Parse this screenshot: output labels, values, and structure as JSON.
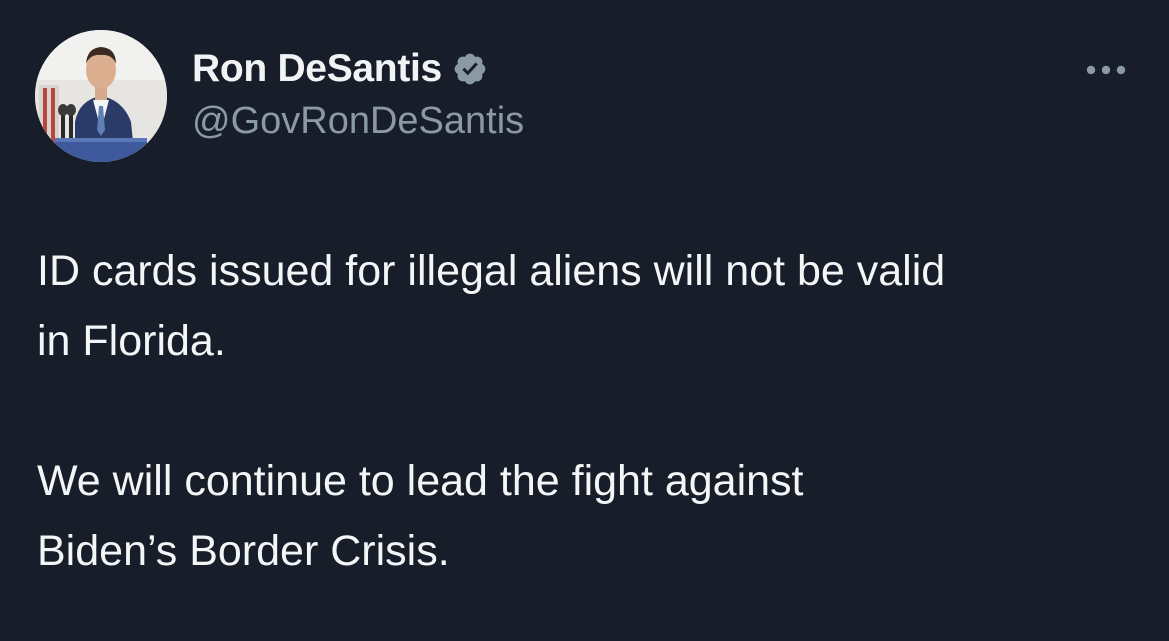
{
  "author": {
    "display_name": "Ron DeSantis",
    "handle": "@GovRonDeSantis",
    "verified": true,
    "verified_color": "#8b98a5"
  },
  "icons": {
    "verified": "verified-badge-icon",
    "more": "more-options-icon"
  },
  "tweet": {
    "paragraphs": [
      {
        "lines": [
          "ID cards issued for illegal aliens will not be valid",
          "in Florida."
        ]
      },
      {
        "lines": [
          "We will continue to lead the fight against",
          "Biden’s Border Crisis."
        ]
      }
    ]
  },
  "colors": {
    "background": "#171e29",
    "primary_text": "#f4f5f7",
    "secondary_text": "#8b98a5"
  }
}
